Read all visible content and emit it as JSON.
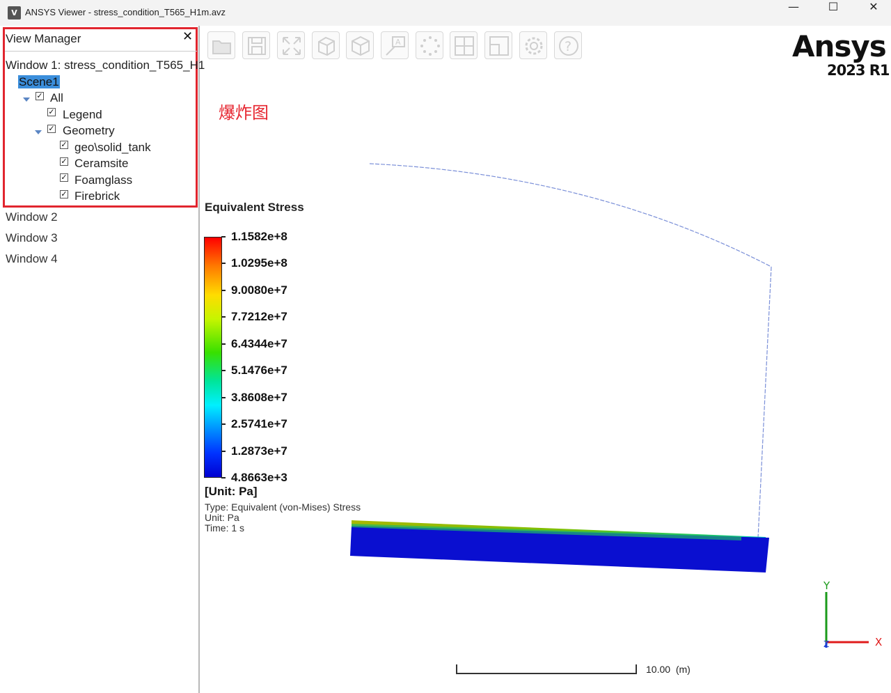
{
  "window": {
    "title": "ANSYS Viewer - stress_condition_T565_H1m.avz",
    "app_icon": "V",
    "minimize": "—",
    "maximize": "☐",
    "close": "✕"
  },
  "view_manager": {
    "title": "View Manager",
    "close": "✕",
    "window1": "Window 1: stress_condition_T565_H1",
    "scene": "Scene1",
    "tree": [
      {
        "label": "All",
        "checked": true
      },
      {
        "label": "Legend",
        "checked": true
      },
      {
        "label": "Geometry",
        "checked": true
      },
      {
        "label": "geo\\solid_tank",
        "checked": true
      },
      {
        "label": "Ceramsite",
        "checked": true
      },
      {
        "label": "Foamglass",
        "checked": true
      },
      {
        "label": "Firebrick",
        "checked": true
      }
    ],
    "windows": [
      "Window 2",
      "Window 3",
      "Window 4"
    ]
  },
  "toolbar": [
    {
      "name": "open-folder-icon"
    },
    {
      "name": "save-icon"
    },
    {
      "name": "fit-view-icon"
    },
    {
      "name": "isometric-view-icon"
    },
    {
      "name": "cube-view-icon"
    },
    {
      "name": "annotate-icon"
    },
    {
      "name": "explode-icon"
    },
    {
      "name": "multi-window-icon"
    },
    {
      "name": "single-window-icon"
    },
    {
      "name": "settings-gear-icon"
    },
    {
      "name": "help-icon"
    }
  ],
  "brand": {
    "name": "Ansys",
    "version": "2023 R1"
  },
  "annotation": "爆炸图",
  "legend": {
    "title": "Equivalent Stress",
    "ticks": [
      "1.1582e+8",
      "1.0295e+8",
      "9.0080e+7",
      "7.7212e+7",
      "6.4344e+7",
      "5.1476e+7",
      "3.8608e+7",
      "2.5741e+7",
      "1.2873e+7",
      "4.8663e+3"
    ],
    "unit": "[Unit: Pa]",
    "type": "Type: Equivalent (von-Mises) Stress",
    "unit_line": "Unit: Pa",
    "time": "Time: 1 s"
  },
  "scale": {
    "value": "10.00",
    "unit": "(m)"
  },
  "axes": {
    "y": "Y",
    "x": "X",
    "z": "Z"
  },
  "colors": {
    "accent_red": "#e1252e",
    "selection_blue": "#3b8edb",
    "legend_max": "#ff0000",
    "legend_min": "#0000d0",
    "axis_x": "#e01b1b",
    "axis_y": "#1a9a1a",
    "axis_z": "#1c3fd6"
  }
}
